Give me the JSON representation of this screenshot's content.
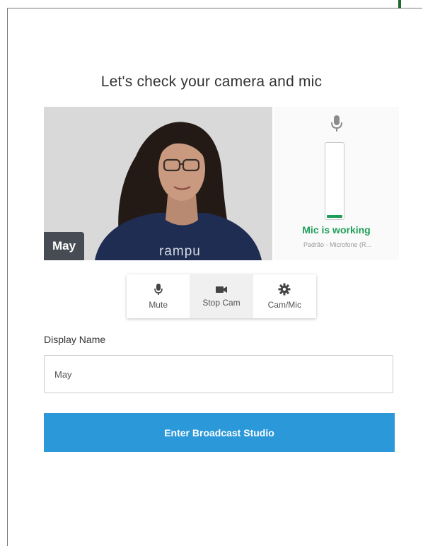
{
  "page": {
    "title": "Let's check your camera and mic"
  },
  "video": {
    "participant_name": "May",
    "shirt_text": "rampu"
  },
  "mic": {
    "status": "Mic is working",
    "device": "Padrão - Microfone (R...",
    "level": 0.04
  },
  "controls": [
    {
      "label": "Mute",
      "icon": "microphone-icon"
    },
    {
      "label": "Stop Cam",
      "icon": "video-camera-icon"
    },
    {
      "label": "Cam/Mic",
      "icon": "gear-icon"
    }
  ],
  "form": {
    "display_name_label": "Display Name",
    "display_name_value": "May",
    "enter_button": "Enter Broadcast Studio"
  },
  "colors": {
    "accent_green": "#1f9e5a",
    "button_blue": "#2b98d9",
    "corner_green": "#1e6b2e"
  }
}
